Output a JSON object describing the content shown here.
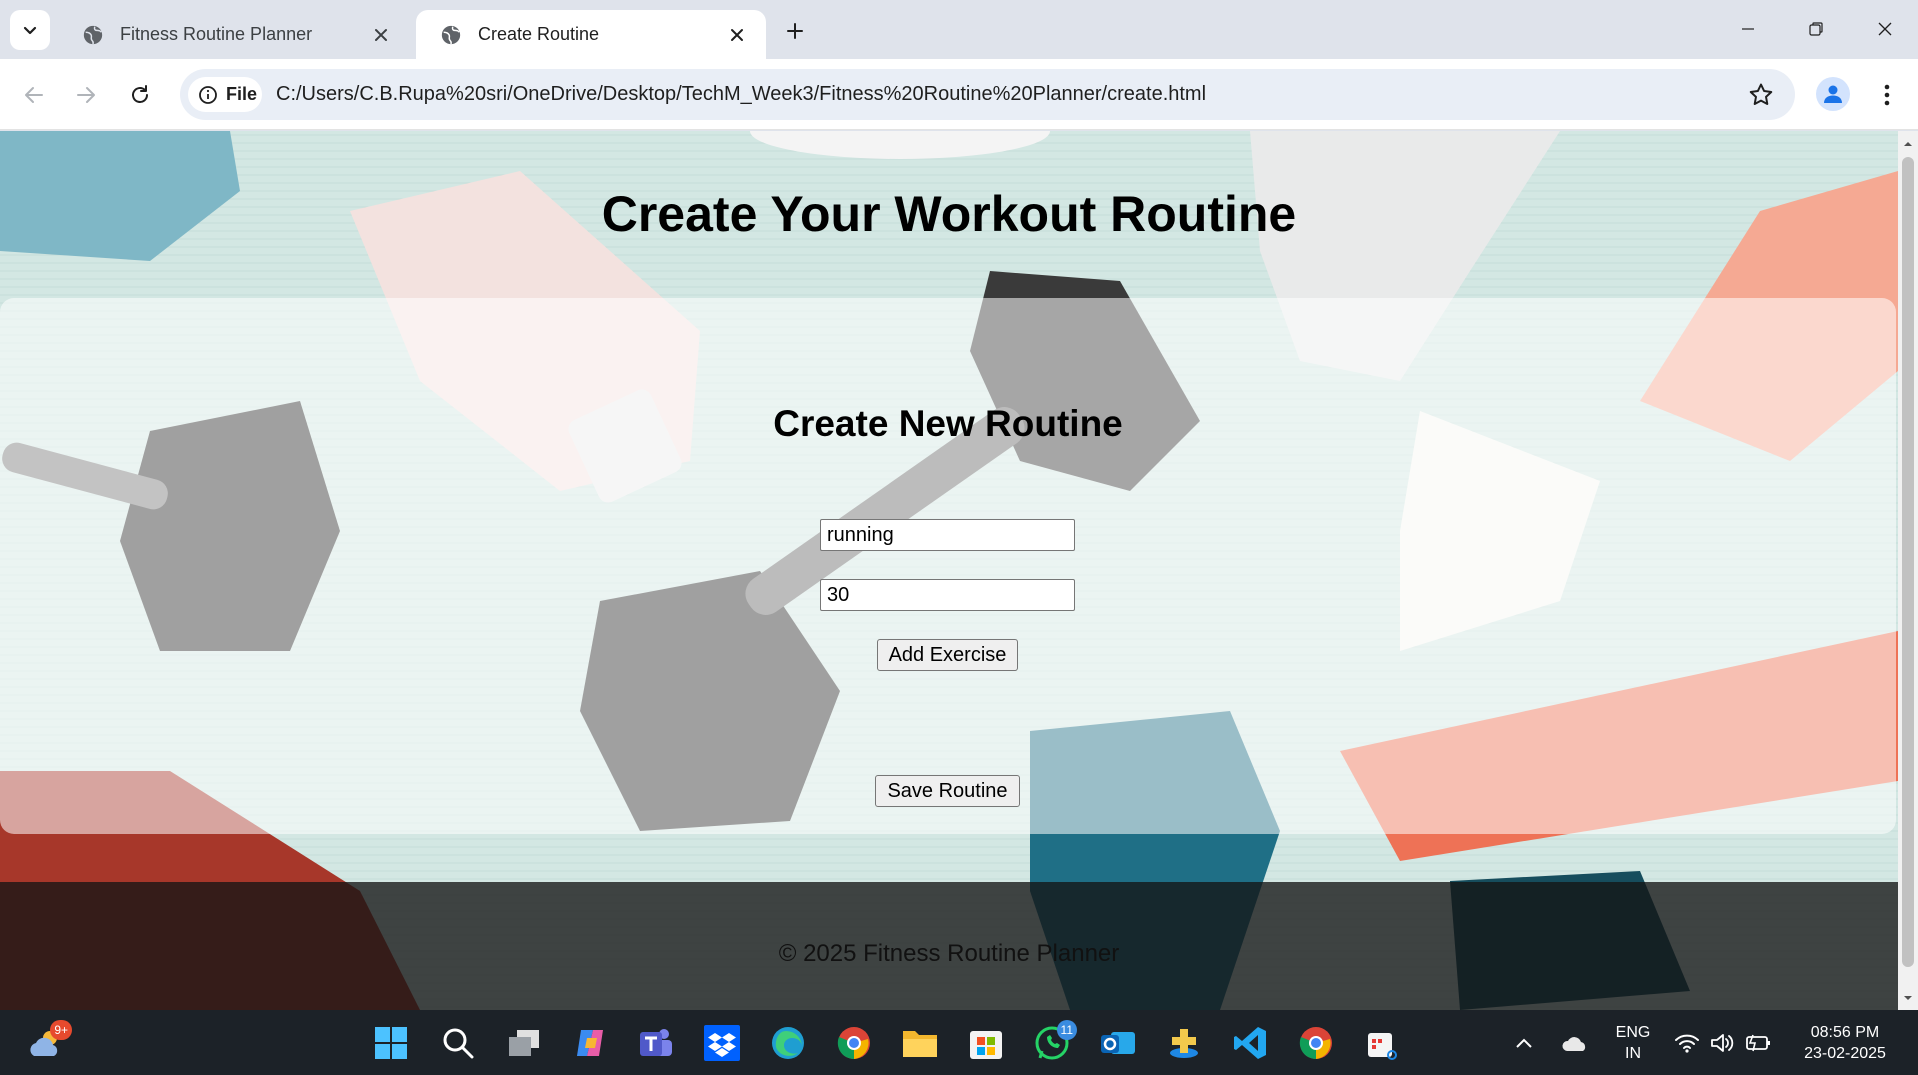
{
  "browser": {
    "tabs": [
      {
        "title": "Fitness Routine Planner",
        "active": false
      },
      {
        "title": "Create Routine",
        "active": true
      }
    ],
    "site_chip": "File",
    "url": "C:/Users/C.B.Rupa%20sri/OneDrive/Desktop/TechM_Week3/Fitness%20Routine%20Planner/create.html"
  },
  "page": {
    "heading": "Create Your Workout Routine",
    "form": {
      "title": "Create New Routine",
      "exercise_value": "running",
      "duration_value": "30",
      "add_button": "Add Exercise",
      "save_button": "Save Routine"
    },
    "footer": "© 2025 Fitness Routine Planner"
  },
  "taskbar": {
    "weather_badge": "9+",
    "whatsapp_badge": "11",
    "language": "ENG",
    "region": "IN",
    "time": "08:56 PM",
    "date": "23-02-2025"
  },
  "colors": {
    "page_bg": "#d6e8e5",
    "accent_blue": "#1a73e8",
    "taskbar": "#1c2228"
  }
}
